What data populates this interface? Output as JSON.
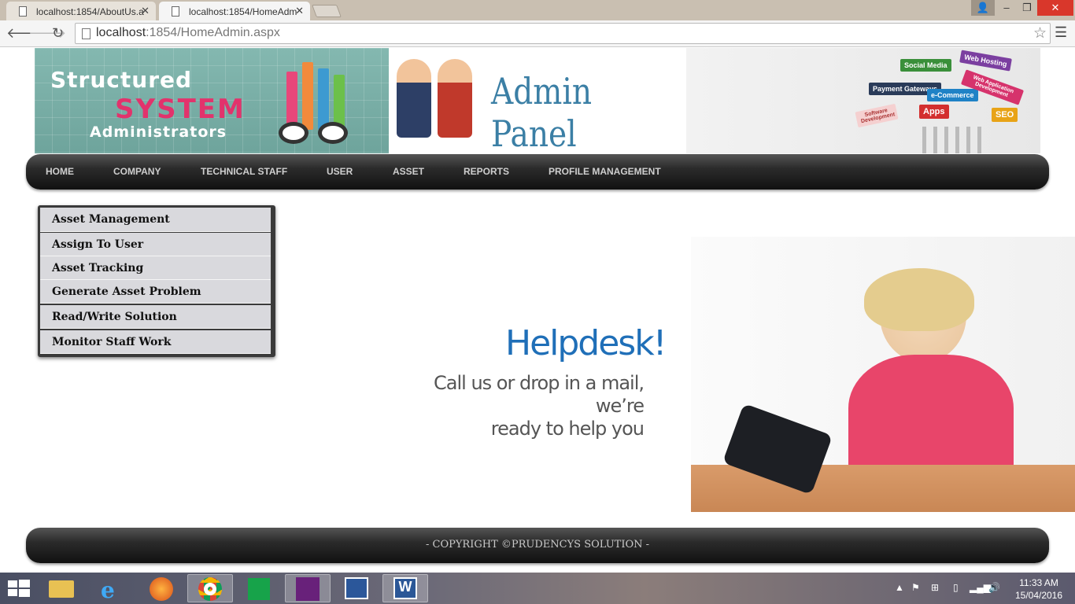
{
  "browser": {
    "tabs": [
      {
        "label": "localhost:1854/AboutUs.a"
      },
      {
        "label": "localhost:1854/HomeAdm"
      }
    ],
    "close_glyph": "✕",
    "url_host": "localhost",
    "url_path": ":1854/HomeAdmin.aspx",
    "window": {
      "minimize": "‒",
      "maximize": "❐",
      "close": "✕"
    }
  },
  "banner": {
    "logo_line1": "Structured",
    "logo_line2": "SYSTEM",
    "logo_line3": "Administrators",
    "title": "Admin Panel",
    "signs": [
      "Social Media",
      "Web Hosting",
      "Payment Gateways",
      "e-Commerce",
      "Web Application Development",
      "Software Development",
      "Apps",
      "SEO"
    ]
  },
  "nav": {
    "items": [
      "HOME",
      "COMPANY",
      "TECHNICAL STAFF",
      "USER",
      "ASSET",
      "REPORTS",
      "PROFILE MANAGEMENT"
    ]
  },
  "asset_menu": {
    "items": [
      "Asset Management",
      "Assign To User",
      "Asset Tracking",
      "Generate Asset Problem",
      "Read/Write Solution",
      "Monitor Staff Work"
    ]
  },
  "helpdesk": {
    "title": "Helpdesk!",
    "line1": "Call us or drop in a mail, we’re",
    "line2": "ready to help you"
  },
  "footer": {
    "copyright": "- COPYRIGHT ©PRUDENCYS SOLUTION -"
  },
  "taskbar": {
    "time": "11:33 AM",
    "date": "15/04/2016",
    "apps": [
      "file-explorer",
      "internet-explorer",
      "firefox",
      "chrome",
      "store",
      "visual-studio",
      "visio",
      "word"
    ]
  },
  "colors": {
    "nav_bg": "#2b2b2b",
    "accent_pink": "#e2336c",
    "helpdesk_blue": "#1f6fb8",
    "close_red": "#d9372b"
  }
}
